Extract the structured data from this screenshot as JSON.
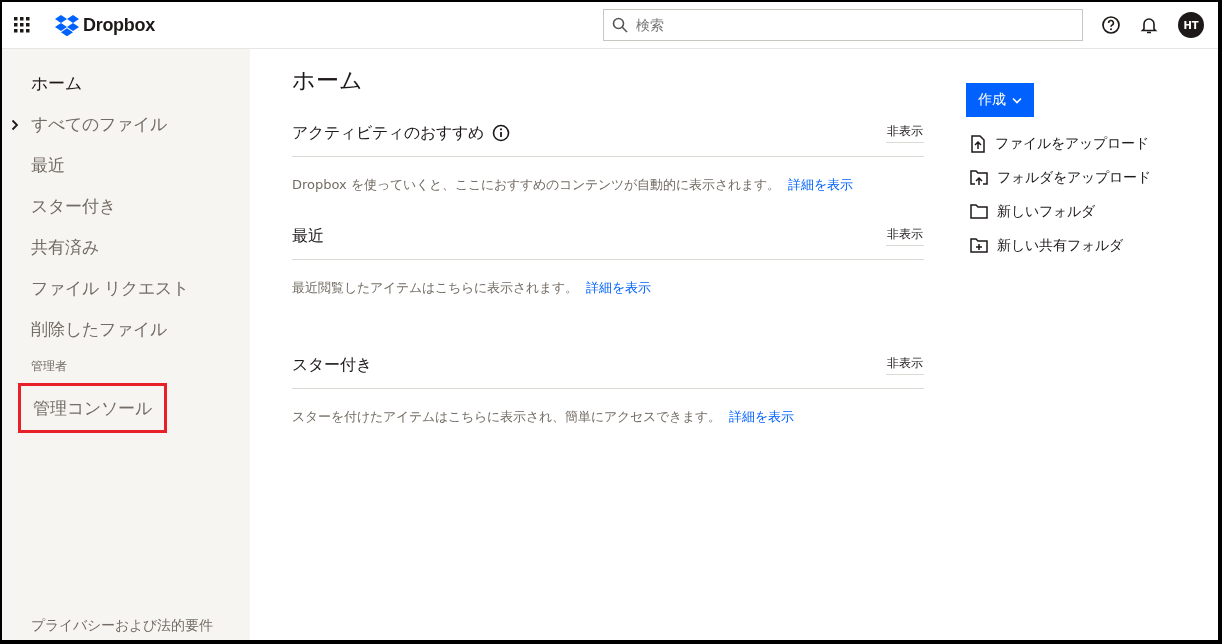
{
  "header": {
    "brand": "Dropbox",
    "search": {
      "placeholder": "検索"
    },
    "avatar": "HT"
  },
  "sidebar": {
    "items": [
      {
        "label": "ホーム",
        "selected": true,
        "expandable": false
      },
      {
        "label": "すべてのファイル",
        "selected": false,
        "expandable": true
      },
      {
        "label": "最近",
        "selected": false,
        "expandable": false
      },
      {
        "label": "スター付き",
        "selected": false,
        "expandable": false
      },
      {
        "label": "共有済み",
        "selected": false,
        "expandable": false
      },
      {
        "label": "ファイル リクエスト",
        "selected": false,
        "expandable": false
      },
      {
        "label": "削除したファイル",
        "selected": false,
        "expandable": false
      }
    ],
    "admin_heading": "管理者",
    "admin_items": [
      {
        "label": "管理コンソール",
        "highlighted": true
      }
    ],
    "footer": "プライバシーおよび法的要件"
  },
  "main": {
    "title": "ホーム",
    "sections": [
      {
        "title": "アクティビティのおすすめ",
        "info": true,
        "hide": "非表示",
        "message": "Dropbox を使っていくと、ここにおすすめのコンテンツが自動的に表示されます。",
        "link": "詳細を表示"
      },
      {
        "title": "最近",
        "info": false,
        "hide": "非表示",
        "message": "最近閲覧したアイテムはこちらに表示されます。",
        "link": "詳細を表示"
      },
      {
        "title": "スター付き",
        "info": false,
        "hide": "非表示",
        "message": "スターを付けたアイテムはこちらに表示され、簡単にアクセスできます。",
        "link": "詳細を表示"
      }
    ]
  },
  "actions": {
    "create": "作成",
    "items": [
      {
        "kind": "upload-file",
        "label": "ファイルをアップロード"
      },
      {
        "kind": "upload-folder",
        "label": "フォルダをアップロード"
      },
      {
        "kind": "new-folder",
        "label": "新しいフォルダ"
      },
      {
        "kind": "shared-folder",
        "label": "新しい共有フォルダ"
      }
    ]
  }
}
